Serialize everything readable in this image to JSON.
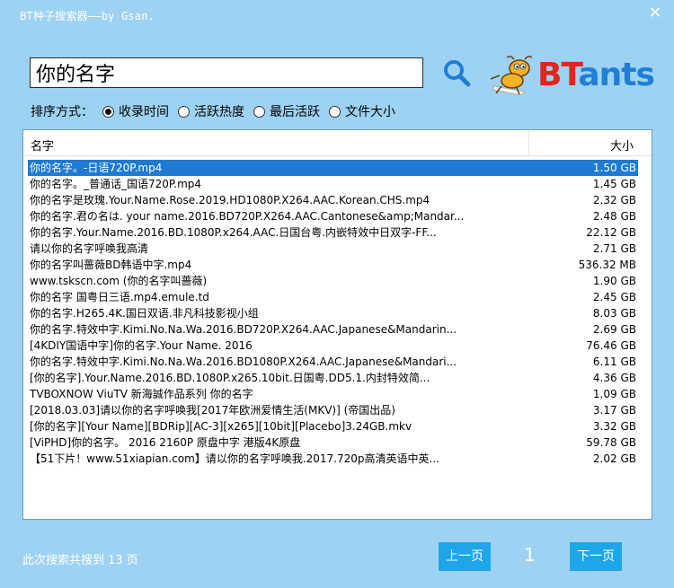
{
  "window": {
    "title": "BT种子搜索器——by Gsan.",
    "close_symbol": "✕"
  },
  "search": {
    "query": "你的名字",
    "button_icon": "search-icon"
  },
  "logo": {
    "bt": "BT",
    "ants": "ants",
    "mascot": "ant-mascot"
  },
  "sort": {
    "label": "排序方式：",
    "options": [
      "收录时间",
      "活跃热度",
      "最后活跃",
      "文件大小"
    ],
    "selected": 0
  },
  "table": {
    "headers": {
      "name": "名字",
      "size": "大小"
    },
    "rows": [
      {
        "name": "你的名字。-日语720P.mp4",
        "size": "1.50 GB"
      },
      {
        "name": "你的名字。_普通话_国语720P.mp4",
        "size": "1.45 GB"
      },
      {
        "name": "你的名字是玫瑰.Your.Name.Rose.2019.HD1080P.X264.AAC.Korean.CHS.mp4",
        "size": "2.32 GB"
      },
      {
        "name": "你的名字.君の名は. your name.2016.BD720P.X264.AAC.Cantonese&amp;Mandar...",
        "size": "2.48 GB"
      },
      {
        "name": "你的名字.Your.Name.2016.BD.1080P.x264.AAC.日国台粤.内嵌特效中日双字-FF...",
        "size": "22.12 GB"
      },
      {
        "name": "请以你的名字呼唤我高清",
        "size": "2.71 GB"
      },
      {
        "name": "你的名字叫蔷薇BD韩语中字.mp4",
        "size": "536.32 MB"
      },
      {
        "name": "www.tsksсn.com (你的名字叫蔷薇)",
        "size": "1.90 GB"
      },
      {
        "name": "你的名字 国粤日三语.mp4.emule.td",
        "size": "2.45 GB"
      },
      {
        "name": "你的名字.H265.4K.国日双语.非凡科技影视小组",
        "size": "8.03 GB"
      },
      {
        "name": "你的名字.特效中字.Kimi.No.Na.Wa.2016.BD720P.X264.AAC.Japanese&Mandarin...",
        "size": "2.69 GB"
      },
      {
        "name": "[4KDIY国语中字]你的名字.Your Name. 2016",
        "size": "76.46 GB"
      },
      {
        "name": "你的名字.特效中字.Kimi.No.Na.Wa.2016.BD1080P.X264.AAC.Japanese&Mandari...",
        "size": "6.11 GB"
      },
      {
        "name": "[你的名字].Your.Name.2016.BD.1080P.x265.10bit.日国粤.DD5.1.内封特效简...",
        "size": "4.36 GB"
      },
      {
        "name": "TVBOXNOW ViuTV 新海誠作品系列 你的名字",
        "size": "1.09 GB"
      },
      {
        "name": "[2018.03.03]请以你的名字呼唤我[2017年欧洲爱情生活(MKV)] (帝国出品)",
        "size": "3.17 GB"
      },
      {
        "name": "[你的名字][Your Name][BDRip][AC-3][x265][10bit][Placebo]3.24GB.mkv",
        "size": "3.32 GB"
      },
      {
        "name": "[ViPHD]你的名字。 2016 2160P 原盘中字 港版4K原盘",
        "size": "59.78 GB"
      },
      {
        "name": "【51下片！www.51xiapian.com】请以你的名字呼唤我.2017.720p高清英语中英...",
        "size": "2.02 GB"
      }
    ],
    "selected_row": 0
  },
  "footer": {
    "status": "此次搜索共搜到 13 页",
    "prev_label": "上一页",
    "page": "1",
    "next_label": "下一页"
  }
}
